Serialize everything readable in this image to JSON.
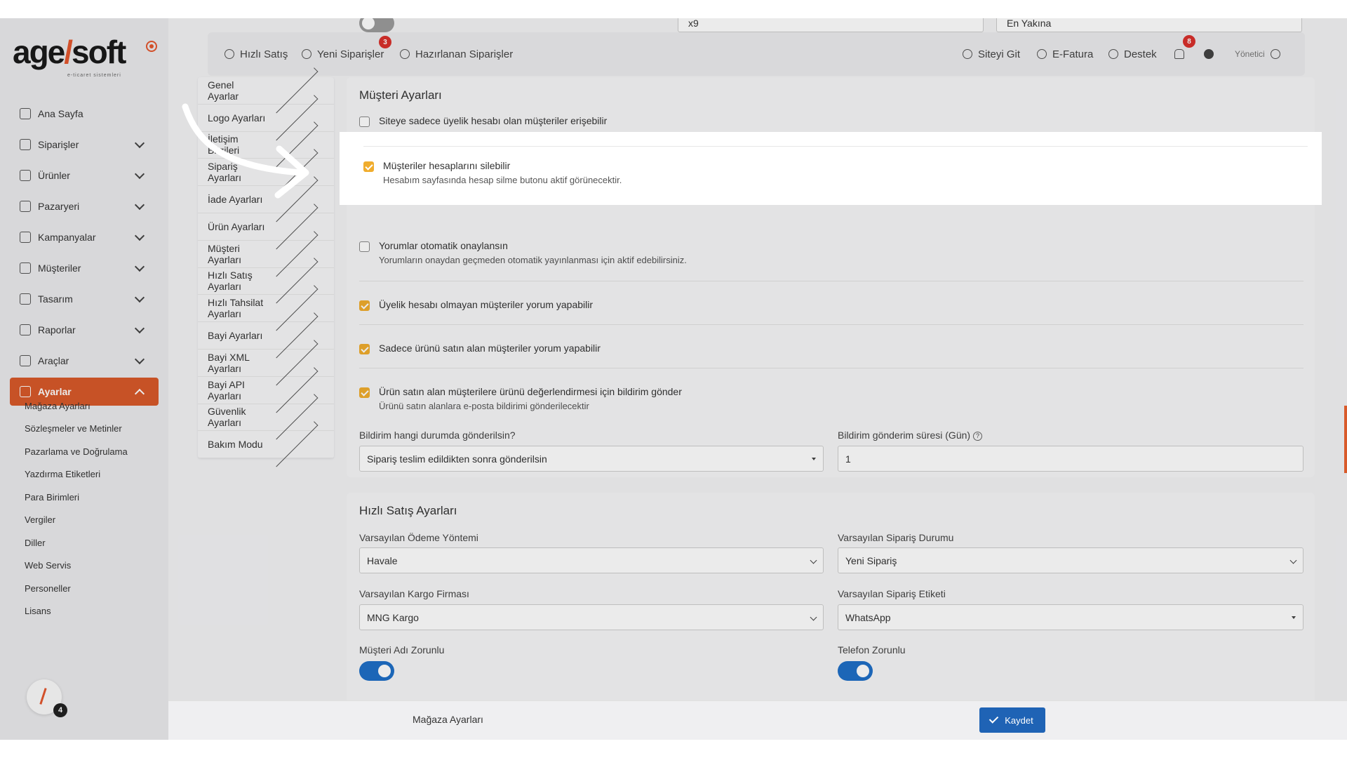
{
  "brand": {
    "logo_text_a": "age",
    "logo_slash": "/",
    "logo_text_b": "soft",
    "logo_sub": "e-ticaret sistemleri",
    "accent": "#d85a2a"
  },
  "sidebar": {
    "items": [
      {
        "label": "Ana Sayfa",
        "icon": "home-icon",
        "has_chevron": false
      },
      {
        "label": "Siparişler",
        "icon": "cart-icon",
        "has_chevron": true
      },
      {
        "label": "Ürünler",
        "icon": "book-icon",
        "has_chevron": true
      },
      {
        "label": "Pazaryeri",
        "icon": "store-icon",
        "has_chevron": true
      },
      {
        "label": "Kampanyalar",
        "icon": "calendar-icon",
        "has_chevron": true
      },
      {
        "label": "Müşteriler",
        "icon": "user-icon",
        "has_chevron": true
      },
      {
        "label": "Tasarım",
        "icon": "edit-icon",
        "has_chevron": true
      },
      {
        "label": "Raporlar",
        "icon": "chart-icon",
        "has_chevron": true
      },
      {
        "label": "Araçlar",
        "icon": "clipboard-icon",
        "has_chevron": true
      },
      {
        "label": "Ayarlar",
        "icon": "gear-icon",
        "has_chevron": true,
        "active": true
      }
    ],
    "subitems": [
      "Mağaza Ayarları",
      "Sözleşmeler ve Metinler",
      "Pazarlama ve Doğrulama",
      "Yazdırma Etiketleri",
      "Para Birimleri",
      "Vergiler",
      "Diller",
      "Web Servis",
      "Personeller",
      "Lisans"
    ],
    "avatar_badge": "4"
  },
  "topbar": {
    "quick_sale": "Hızlı Satış",
    "new_orders": "Yeni Siparişler",
    "new_orders_badge": "3",
    "prepared_orders": "Hazırlanan Siparişler",
    "goto_site": "Siteyi Git",
    "einvoice": "E-Fatura",
    "support": "Destek",
    "notif_badge": "8",
    "user": "Yönetici"
  },
  "top_hidden_row": {
    "select_a": "x9",
    "select_b": "En Yakına"
  },
  "settings_menu": [
    "Genel Ayarlar",
    "Logo Ayarları",
    "İletişim Bilgileri",
    "Sipariş Ayarları",
    "İade Ayarları",
    "Ürün Ayarları",
    "Müşteri Ayarları",
    "Hızlı Satış Ayarları",
    "Hızlı Tahsilat Ayarları",
    "Bayi Ayarları",
    "Bayi XML Ayarları",
    "Bayi API Ayarları",
    "Güvenlik Ayarları",
    "Bakım Modu"
  ],
  "customer_settings": {
    "title": "Müşteri Ayarları",
    "opt1": {
      "label": "Siteye sadece üyelik hesabı olan müşteriler erişebilir",
      "checked": false
    },
    "opt2": {
      "label": "Müşteriler hesaplarını silebilir",
      "desc": "Hesabım sayfasında hesap silme butonu aktif görünecektir.",
      "checked": true
    },
    "opt3": {
      "label": "Yorumlar otomatik onaylansın",
      "desc": "Yorumların onaydan geçmeden otomatik yayınlanması için aktif edebilirsiniz.",
      "checked": false
    },
    "opt4": {
      "label": "Üyelik hesabı olmayan müşteriler yorum yapabilir",
      "checked": true
    },
    "opt5": {
      "label": "Sadece ürünü satın alan müşteriler yorum yapabilir",
      "checked": true
    },
    "opt6": {
      "label": "Ürün satın alan müşterilere ürünü değerlendirmesi için bildirim gönder",
      "desc": "Ürünü satın alanlara e-posta bildirimi gönderilecektir",
      "checked": true
    },
    "notify_when_label": "Bildirim hangi durumda gönderilsin?",
    "notify_when_value": "Sipariş teslim edildikten sonra gönderilsin",
    "notify_days_label": "Bildirim gönderim süresi (Gün)",
    "notify_days_value": "1"
  },
  "quick_sale_settings": {
    "title": "Hızlı Satış Ayarları",
    "payment_label": "Varsayılan Ödeme Yöntemi",
    "payment_value": "Havale",
    "order_status_label": "Varsayılan Sipariş Durumu",
    "order_status_value": "Yeni Sipariş",
    "cargo_label": "Varsayılan Kargo Firması",
    "cargo_value": "MNG Kargo",
    "order_tag_label": "Varsayılan Sipariş Etiketi",
    "order_tag_value": "WhatsApp",
    "customer_name_required_label": "Müşteri Adı Zorunlu",
    "customer_name_required": true,
    "phone_required_label": "Telefon Zorunlu",
    "phone_required": true
  },
  "bottombar": {
    "title": "Mağaza Ayarları",
    "save": "Kaydet"
  }
}
